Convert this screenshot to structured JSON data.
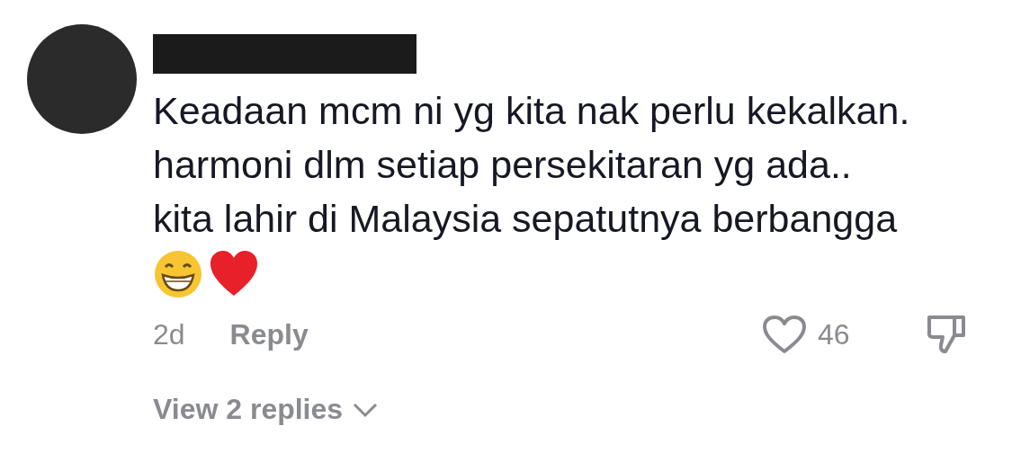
{
  "comment": {
    "lines": [
      "Keadaan mcm ni yg kita nak perlu kekalkan.",
      "harmoni dlm setiap persekitaran yg ada..",
      "kita lahir di Malaysia sepatutnya berbangga"
    ],
    "time": "2d",
    "reply_label": "Reply",
    "like_count": "46",
    "liked": false,
    "disliked": false
  },
  "replies": {
    "label": "View 2 replies",
    "expanded": false
  }
}
